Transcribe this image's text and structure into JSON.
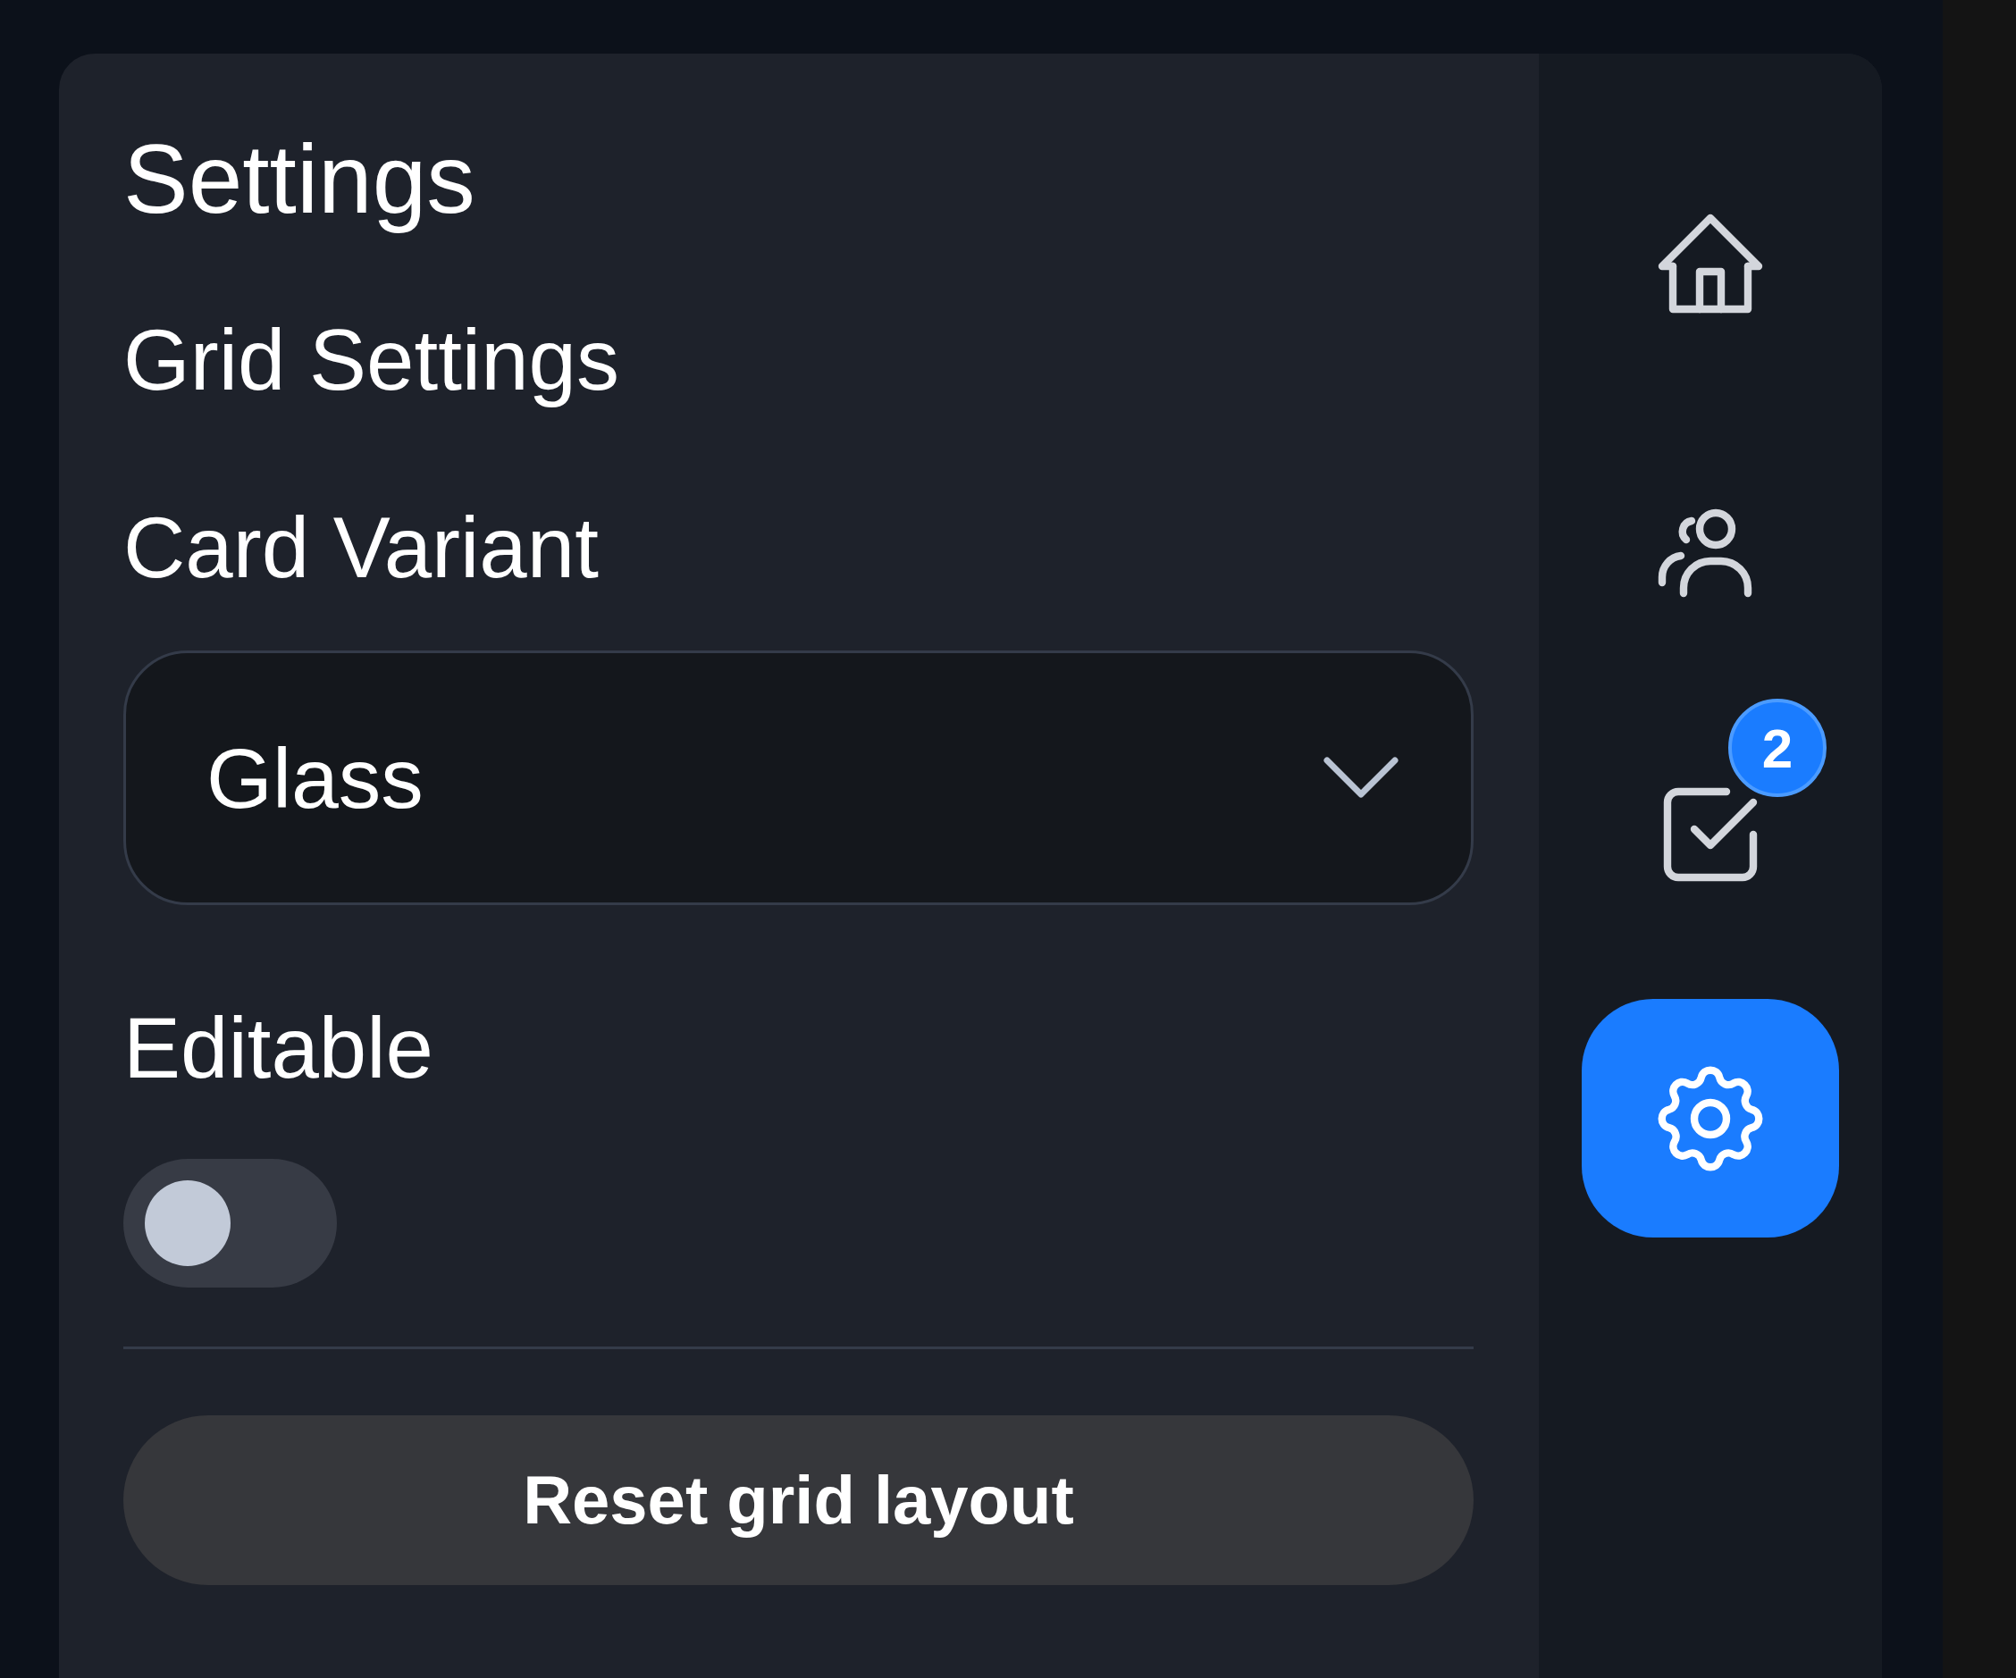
{
  "title": "Settings",
  "section": "Grid Settings",
  "card_variant": {
    "label": "Card Variant",
    "value": "Glass"
  },
  "editable": {
    "label": "Editable",
    "on": false
  },
  "reset_button": "Reset grid layout",
  "rail": [
    {
      "kind": "home",
      "selected": false
    },
    {
      "kind": "users",
      "selected": false
    },
    {
      "kind": "tasks",
      "selected": false,
      "badge": "2"
    },
    {
      "kind": "settings",
      "selected": true
    }
  ]
}
